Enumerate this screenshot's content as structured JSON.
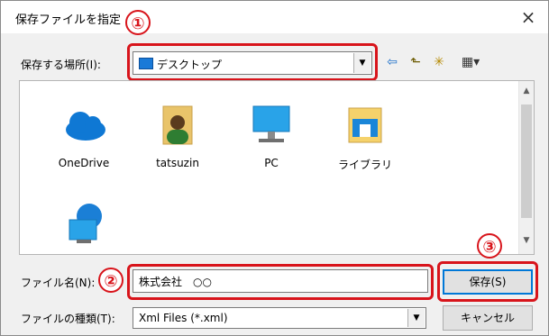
{
  "window": {
    "title": "保存ファイルを指定",
    "close": "×"
  },
  "location": {
    "label": "保存する場所(I):",
    "value": "デスクトップ"
  },
  "toolbar": {
    "back_glyph": "⇦",
    "up_glyph": "⬑",
    "newfolder_glyph": "✳",
    "view_glyph": "▦▾"
  },
  "items": [
    {
      "name": "OneDrive"
    },
    {
      "name": "tatsuzin"
    },
    {
      "name": "PC"
    },
    {
      "name": "ライブラリ"
    }
  ],
  "filename": {
    "label": "ファイル名(N):",
    "value": "株式会社　○○"
  },
  "filetype": {
    "label": "ファイルの種類(T):",
    "value": "Xml Files (*.xml)"
  },
  "buttons": {
    "save": "保存(S)",
    "cancel": "キャンセル"
  },
  "annotations": {
    "one": "①",
    "two": "②",
    "three": "③"
  },
  "colors": {
    "annotation_red": "#d8141b",
    "accent_blue": "#0078d7"
  }
}
